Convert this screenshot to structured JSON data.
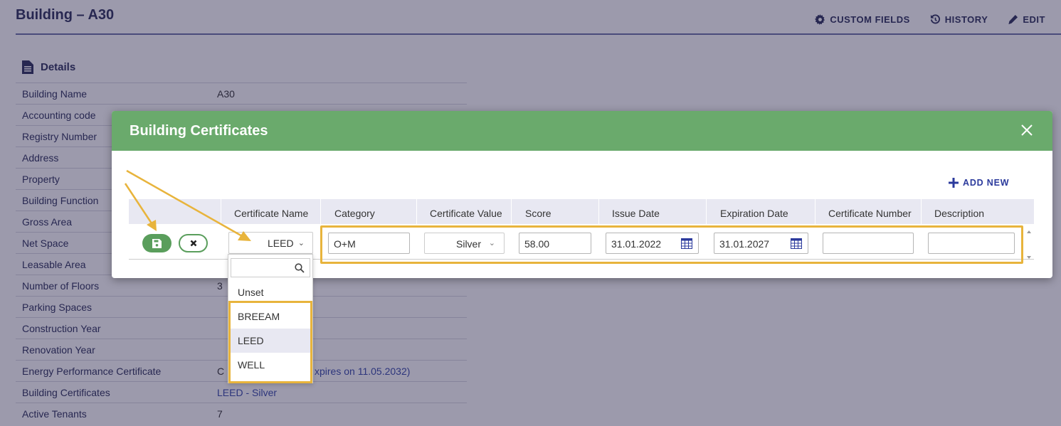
{
  "page": {
    "title": "Building – A30",
    "actions": [
      {
        "label": "CUSTOM FIELDS",
        "icon": "gear-icon"
      },
      {
        "label": "HISTORY",
        "icon": "history-icon"
      },
      {
        "label": "EDIT",
        "icon": "pencil-icon"
      }
    ],
    "details_heading": "Details",
    "details": [
      {
        "label": "Building Name",
        "value": "A30"
      },
      {
        "label": "Accounting code",
        "value": ""
      },
      {
        "label": "Registry Number",
        "value": ""
      },
      {
        "label": "Address",
        "value": ""
      },
      {
        "label": "Property",
        "value": ""
      },
      {
        "label": "Building Function",
        "value": ""
      },
      {
        "label": "Gross Area",
        "value": ""
      },
      {
        "label": "Net Space",
        "value": ""
      },
      {
        "label": "Leasable Area",
        "value": ""
      },
      {
        "label": "Number of Floors",
        "value": "3"
      },
      {
        "label": "Parking Spaces",
        "value": ""
      },
      {
        "label": "Construction Year",
        "value": ""
      },
      {
        "label": "Renovation Year",
        "value": ""
      },
      {
        "label": "Energy Performance Certificate",
        "value": "C",
        "value_tail": "xpires on 11.05.2032)"
      },
      {
        "label": "Building Certificates",
        "value": "LEED - Silver"
      },
      {
        "label": "Active Tenants",
        "value": "7"
      }
    ]
  },
  "modal": {
    "title": "Building Certificates",
    "add_new_label": "ADD NEW",
    "columns": [
      "Certificate Name",
      "Category",
      "Certificate Value",
      "Score",
      "Issue Date",
      "Expiration Date",
      "Certificate Number",
      "Description"
    ],
    "row": {
      "certificate_name": "LEED",
      "category": "O+M",
      "certificate_value": "Silver",
      "score": "58.00",
      "issue_date": "31.01.2022",
      "expiration_date": "31.01.2027",
      "certificate_number": "",
      "description": ""
    }
  },
  "dropdown": {
    "search_value": "",
    "options": [
      "Unset",
      "BREEAM",
      "LEED",
      "WELL"
    ],
    "active_option": "LEED"
  },
  "colors": {
    "modal_header": "#6aaa6c",
    "highlight": "#e8b43c",
    "accent_blue": "#2b3a9c",
    "save_green": "#5a9e5c"
  }
}
